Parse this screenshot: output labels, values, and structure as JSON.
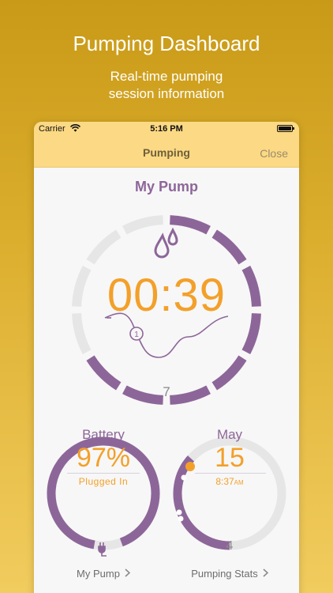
{
  "promo": {
    "title": "Pumping Dashboard",
    "subtitle_line1": "Real-time pumping",
    "subtitle_line2": "session information"
  },
  "status_bar": {
    "carrier": "Carrier",
    "time": "5:16 PM"
  },
  "nav": {
    "title": "Pumping",
    "close_label": "Close"
  },
  "pump": {
    "name": "My Pump",
    "timer": "00:39",
    "wave_marker": "1",
    "cycle_count": "7",
    "progress_segments_total": 12,
    "progress_segments_filled": 8
  },
  "battery": {
    "label": "Battery",
    "value": "97%",
    "status": "Plugged In",
    "level_fraction": 0.97
  },
  "stats": {
    "month": "May",
    "day": "15",
    "time": "8:37",
    "ampm": "AM",
    "session_count": "4"
  },
  "links": {
    "my_pump": "My Pump",
    "pumping_stats": "Pumping Stats"
  },
  "colors": {
    "purple": "#8d6699",
    "orange": "#f3a02a",
    "track": "#e6e6e6",
    "header_yellow": "#fcd984"
  }
}
